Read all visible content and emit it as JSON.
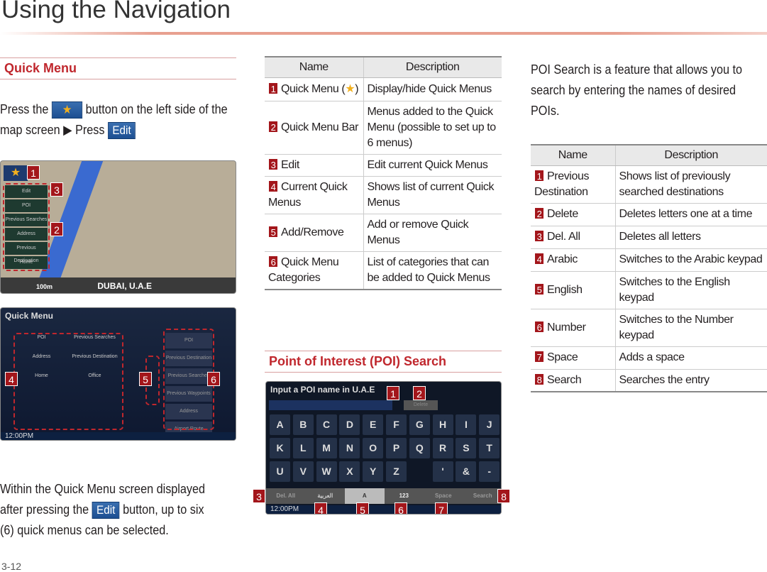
{
  "page": {
    "title": "Using the Navigation",
    "page_number": "3-12"
  },
  "quick_menu": {
    "heading": "Quick Menu",
    "intro_1": "Press the",
    "intro_2": "button on the left side of the",
    "intro_3": "map screen ▶  Press",
    "edit_label": "Edit",
    "star_icon": "★",
    "outro_1": "Within the Quick Menu screen displayed",
    "outro_2": "after pressing the",
    "outro_3": "button, up to six",
    "outro_4": "(6) quick menus can be selected.",
    "map_screen": {
      "items": [
        "Edit",
        "POI",
        "Previous Searches",
        "Address",
        "Previous Destination",
        "Home"
      ],
      "scale": "100m",
      "location": "DUBAI, U.A.E"
    },
    "menu_screen": {
      "title": "Quick Menu",
      "icons": [
        "POI",
        "Previous Searches",
        "Address",
        "Previous Destination",
        "Home",
        "Office"
      ],
      "list": [
        "POI",
        "Previous Destination",
        "Previous Searches",
        "Previous Waypoints",
        "Address",
        "Airport Route"
      ],
      "clock": "12:00PM"
    },
    "table": {
      "headers": [
        "Name",
        "Description"
      ],
      "rows": [
        {
          "num": "1",
          "name": "Quick Menu (",
          "name_star": "★",
          "name_end": ")",
          "desc": "Display/hide Quick Menus"
        },
        {
          "num": "2",
          "name": "Quick Menu Bar",
          "desc": "Menus added to the Quick Menu (possible to set up to 6 menus)"
        },
        {
          "num": "3",
          "name": "Edit",
          "desc": "Edit current Quick Menus"
        },
        {
          "num": "4",
          "name": "Current Quick Menus",
          "desc": "Shows list of current Quick Menus"
        },
        {
          "num": "5",
          "name": "Add/Remove",
          "desc": "Add or remove Quick Menus"
        },
        {
          "num": "6",
          "name": "Quick Menu Categories",
          "desc": "List of categories that can be added to Quick Menus"
        }
      ]
    }
  },
  "poi": {
    "heading": "Point of Interest (POI) Search",
    "intro": "POI Search is a feature that allows you to search by entering the names of desired POIs.",
    "screen": {
      "title": "Input a POI name in U.A.E",
      "delete": "Delete",
      "keys": [
        "A",
        "B",
        "C",
        "D",
        "E",
        "F",
        "G",
        "H",
        "I",
        "J",
        "K",
        "L",
        "M",
        "N",
        "O",
        "P",
        "Q",
        "R",
        "S",
        "T",
        "U",
        "V",
        "W",
        "X",
        "Y",
        "Z",
        "",
        "'",
        "&",
        "-"
      ],
      "bottom": [
        "Del. All",
        "العربية",
        "A",
        "123",
        "Space",
        "Search"
      ],
      "clock": "12:00PM"
    },
    "table": {
      "headers": [
        "Name",
        "Description"
      ],
      "rows": [
        {
          "num": "1",
          "name": "Previous Destination",
          "desc": "Shows list of previously searched destinations"
        },
        {
          "num": "2",
          "name": "Delete",
          "desc": "Deletes letters one at a time"
        },
        {
          "num": "3",
          "name": "Del. All",
          "desc": "Deletes all letters"
        },
        {
          "num": "4",
          "name": "Arabic",
          "desc": "Switches to the Arabic keypad"
        },
        {
          "num": "5",
          "name": "English",
          "desc": "Switches to the English keypad"
        },
        {
          "num": "6",
          "name": "Number",
          "desc": "Switches to the Number keypad"
        },
        {
          "num": "7",
          "name": "Space",
          "desc": "Adds a space"
        },
        {
          "num": "8",
          "name": "Search",
          "desc": "Searches the entry"
        }
      ]
    }
  },
  "colors": {
    "accent": "#c0272d",
    "badge": "#a3161b",
    "button": "#1d4f92"
  }
}
